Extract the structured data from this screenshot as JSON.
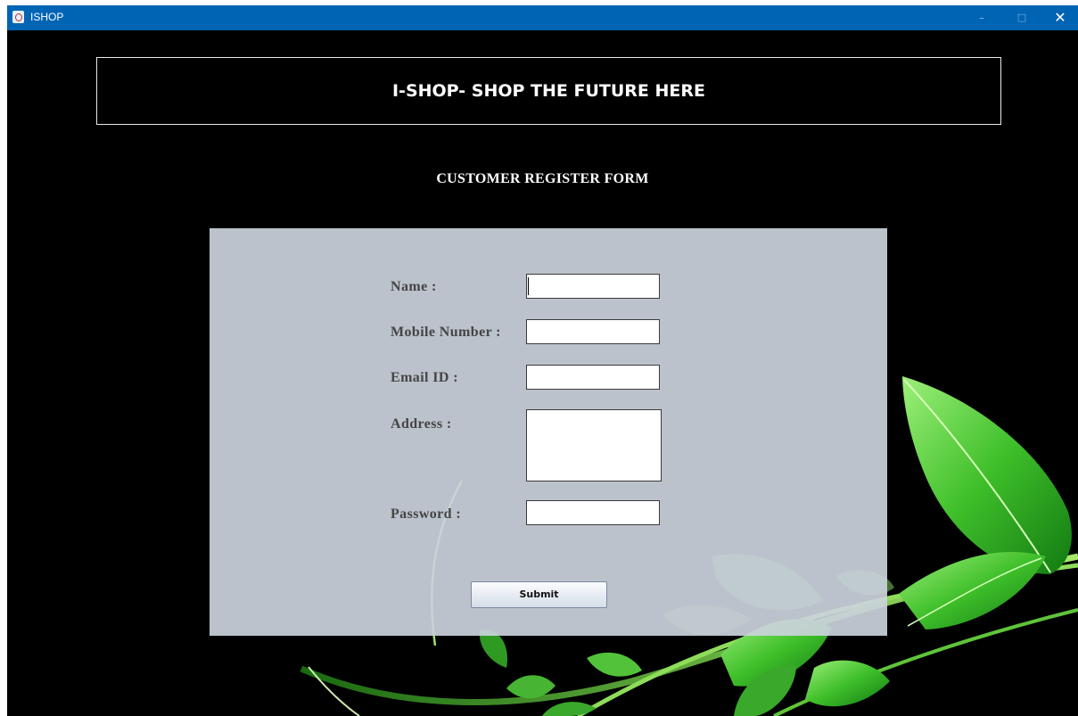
{
  "window": {
    "title": "ISHOP",
    "controls": {
      "minimize": "–",
      "maximize": "□",
      "close": "✕"
    }
  },
  "banner": {
    "text": "I-SHOP- SHOP THE FUTURE HERE"
  },
  "form": {
    "heading": "CUSTOMER REGISTER FORM",
    "fields": {
      "name": {
        "label": "Name :",
        "value": ""
      },
      "mobile": {
        "label": "Mobile Number :",
        "value": ""
      },
      "email": {
        "label": "Email ID :",
        "value": ""
      },
      "address": {
        "label": "Address :",
        "value": ""
      },
      "password": {
        "label": "Password :",
        "value": ""
      }
    },
    "submit_label": "Submit"
  },
  "colors": {
    "titlebar": "#0064b4",
    "background": "#000000",
    "panel": "#cbd2dc",
    "label_text": "#454545",
    "leaf_green": "#3fbf2a"
  },
  "icons": {
    "app": "java-app-icon",
    "background_art": "green-leaves-vine"
  }
}
